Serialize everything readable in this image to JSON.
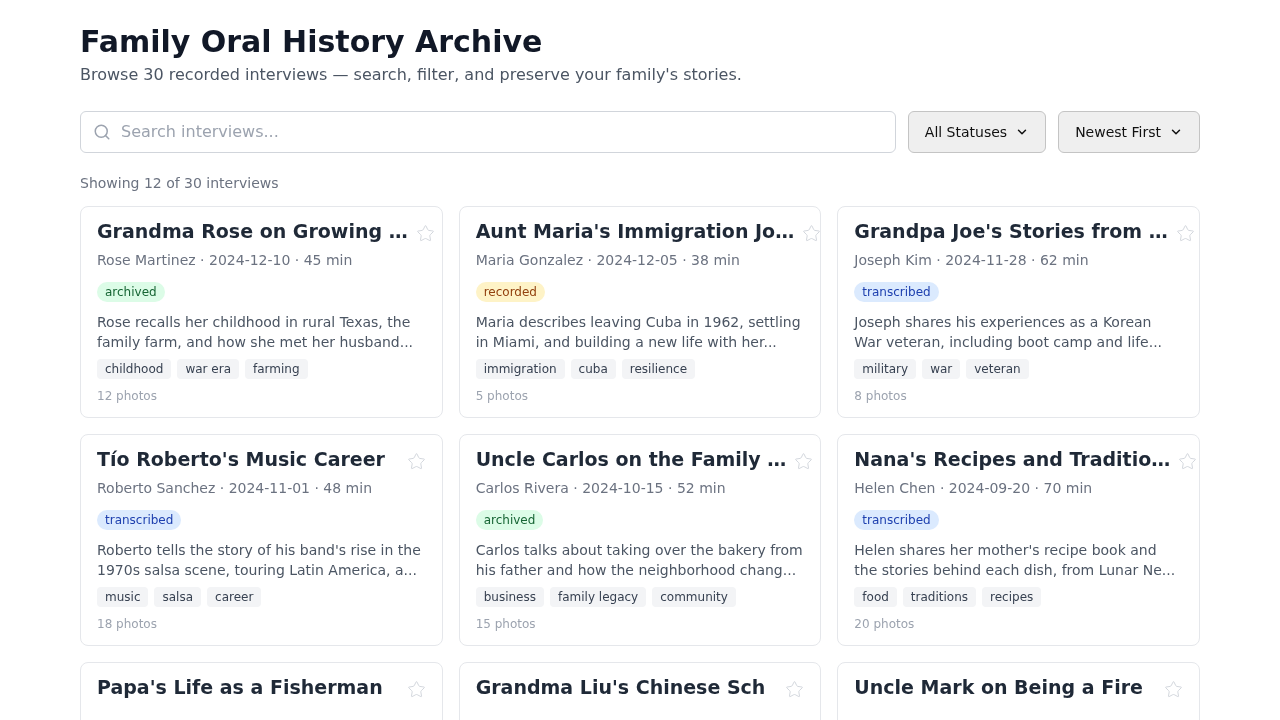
{
  "header": {
    "title": "Family Oral History Archive",
    "subtitle": "Browse 30 recorded interviews — search, filter, and preserve your family's stories."
  },
  "search": {
    "placeholder": "Search interviews..."
  },
  "filters": [
    {
      "value": "All Statuses"
    },
    {
      "value": "Newest First"
    }
  ],
  "count": "Showing 12 of 30 interviews",
  "interviews": [
    {
      "title": "Grandma Rose on Growing …",
      "starred": false,
      "meta": "Rose Martinez · 2024-12-10 · 45 min",
      "status": "archived",
      "summary": "Rose recalls her childhood in rural Texas, the family farm, and how she met her husband...",
      "tags": [
        "childhood",
        "war era",
        "farming"
      ],
      "photos": "12 photos"
    },
    {
      "title": "Aunt Maria's Immigration Jo…",
      "starred": false,
      "meta": "Maria Gonzalez · 2024-12-05 · 38 min",
      "status": "recorded",
      "summary": "Maria describes leaving Cuba in 1962, settling in Miami, and building a new life with her...",
      "tags": [
        "immigration",
        "cuba",
        "resilience"
      ],
      "photos": "5 photos"
    },
    {
      "title": "Grandpa Joe's Stories from …",
      "starred": false,
      "meta": "Joseph Kim · 2024-11-28 · 62 min",
      "status": "transcribed",
      "summary": "Joseph shares his experiences as a Korean War veteran, including boot camp and life...",
      "tags": [
        "military",
        "war",
        "veteran"
      ],
      "photos": "8 photos"
    },
    {
      "title": "Tío Roberto's Music Career",
      "starred": false,
      "meta": "Roberto Sanchez · 2024-11-01 · 48 min",
      "status": "transcribed",
      "summary": "Roberto tells the story of his band's rise in the 1970s salsa scene, touring Latin America, a...",
      "tags": [
        "music",
        "salsa",
        "career"
      ],
      "photos": "18 photos"
    },
    {
      "title": "Uncle Carlos on the Family …",
      "starred": false,
      "meta": "Carlos Rivera · 2024-10-15 · 52 min",
      "status": "archived",
      "summary": "Carlos talks about taking over the bakery from his father and how the neighborhood chang...",
      "tags": [
        "business",
        "family legacy",
        "community"
      ],
      "photos": "15 photos"
    },
    {
      "title": "Nana's Recipes and Traditio…",
      "starred": false,
      "meta": "Helen Chen · 2024-09-20 · 70 min",
      "status": "transcribed",
      "summary": "Helen shares her mother's recipe book and the stories behind each dish, from Lunar Ne...",
      "tags": [
        "food",
        "traditions",
        "recipes"
      ],
      "photos": "20 photos"
    },
    {
      "title": "Papa's Life as a Fisherman",
      "starred": false
    },
    {
      "title": "Grandma Liu's Chinese Sch",
      "starred": false
    },
    {
      "title": "Uncle Mark on Being a Fire",
      "starred": false
    }
  ]
}
